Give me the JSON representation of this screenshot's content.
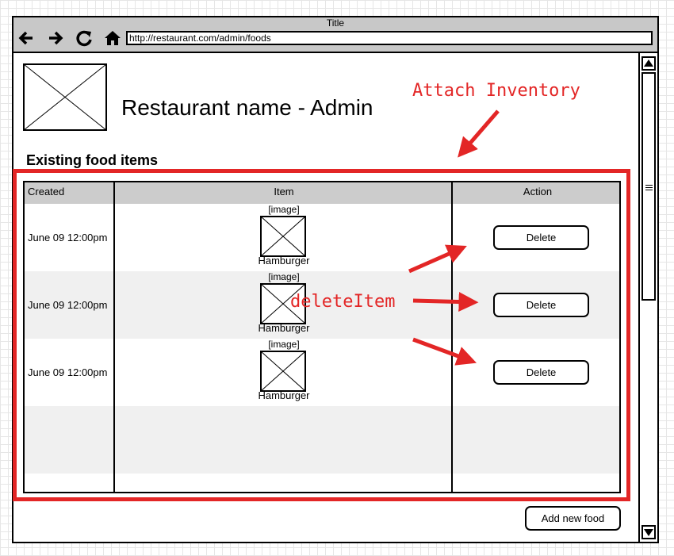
{
  "window": {
    "title": "Title",
    "url": "http://restaurant.com/admin/foods"
  },
  "nav": {
    "icons": [
      "back-arrow-icon",
      "forward-arrow-icon",
      "refresh-icon",
      "home-icon"
    ]
  },
  "page": {
    "title": "Restaurant name - Admin",
    "section_heading": "Existing food items"
  },
  "table": {
    "columns": [
      "Created",
      "Item",
      "Action"
    ],
    "rows": [
      {
        "created": "June 09 12:00pm",
        "image_label": "[image]",
        "item": "Hamburger",
        "action": "Delete"
      },
      {
        "created": "June 09 12:00pm",
        "image_label": "[image]",
        "item": "Hamburger",
        "action": "Delete"
      },
      {
        "created": "June 09 12:00pm",
        "image_label": "[image]",
        "item": "Hamburger",
        "action": "Delete"
      }
    ]
  },
  "add_button": "Add new food",
  "annotations": {
    "attach": "Attach Inventory",
    "delete": "deleteItem",
    "color": "#e32626"
  },
  "colors": {
    "header_bg": "#cccccc",
    "titlebar_bg": "#c8c8c8",
    "alt_row_bg": "#f0f0f0"
  }
}
